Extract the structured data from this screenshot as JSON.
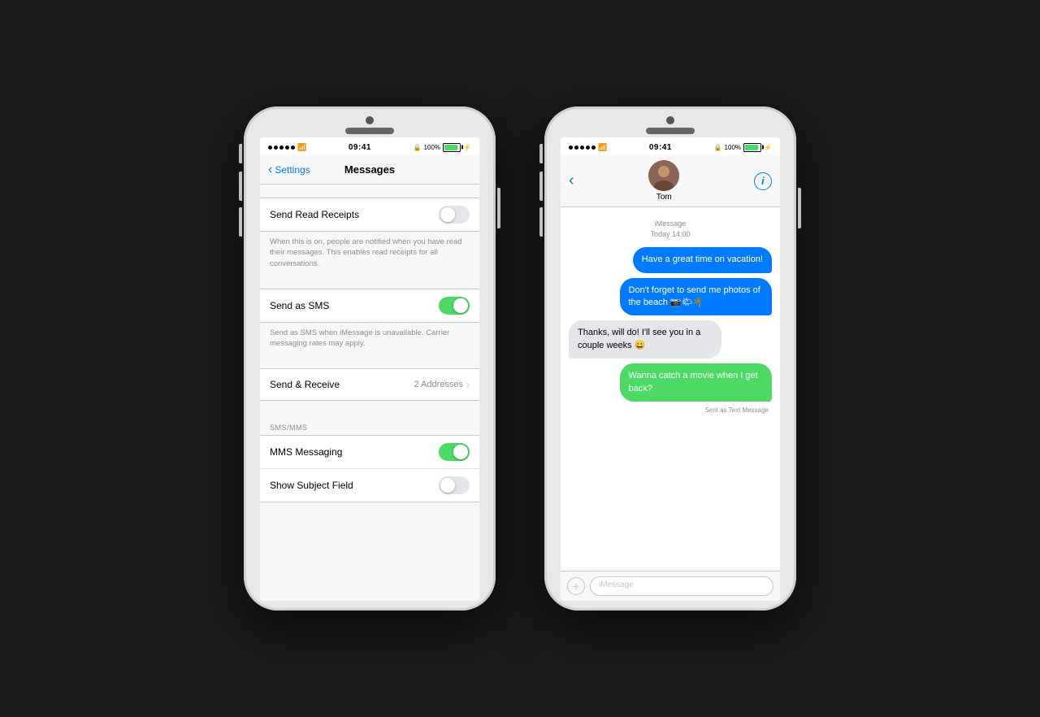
{
  "phones": {
    "left": {
      "statusBar": {
        "time": "09:41",
        "battery": "100%"
      },
      "nav": {
        "back": "Settings",
        "title": "Messages"
      },
      "rows": [
        {
          "label": "Send Read Receipts",
          "toggleState": "off",
          "description": "When this is on, people are notified when you have read their messages. This enables read receipts for all conversations."
        },
        {
          "label": "Send as SMS",
          "toggleState": "on",
          "description": "Send as SMS when iMessage is unavailable. Carrier messaging rates may apply."
        },
        {
          "label": "Send & Receive",
          "value": "2 Addresses",
          "hasChevron": true
        }
      ],
      "smsSection": {
        "header": "SMS/MMS",
        "rows": [
          {
            "label": "MMS Messaging",
            "toggleState": "on"
          },
          {
            "label": "Show Subject Field",
            "toggleState": "off"
          }
        ]
      }
    },
    "right": {
      "statusBar": {
        "time": "09:41",
        "battery": "100%"
      },
      "contact": {
        "name": "Tom"
      },
      "timestamp": {
        "service": "iMessage",
        "time": "Today 14:00"
      },
      "messages": [
        {
          "text": "Have a great time on vacation!",
          "type": "sent",
          "color": "blue"
        },
        {
          "text": "Don't forget to send me photos of the beach 📷🌤🌴",
          "type": "sent",
          "color": "blue"
        },
        {
          "text": "Thanks, will do! I'll see you in a couple weeks 😀",
          "type": "received",
          "color": "gray"
        },
        {
          "text": "Wanna catch a movie when I get back?",
          "type": "sent",
          "color": "green",
          "sentAs": "Sent as Text Message"
        }
      ]
    }
  }
}
